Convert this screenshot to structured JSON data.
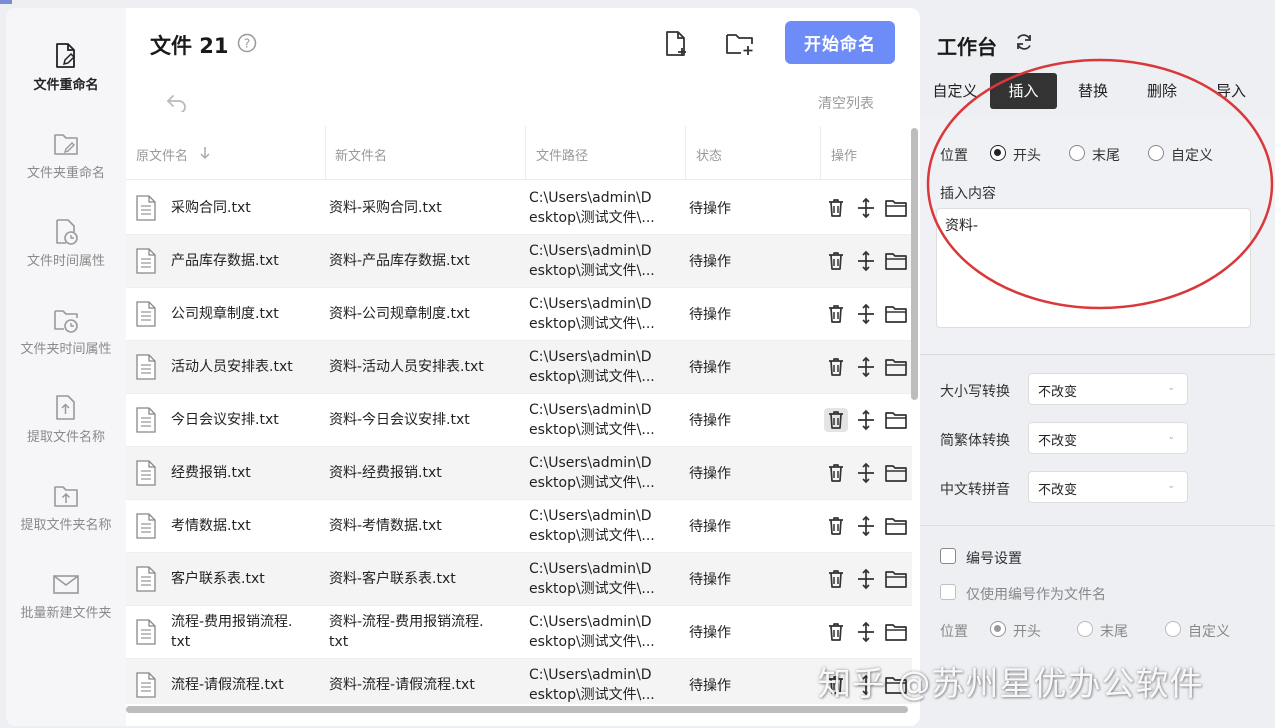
{
  "sidebar": {
    "items": [
      {
        "label": "文件重命名",
        "icon": "file-edit-icon",
        "active": true
      },
      {
        "label": "文件夹重命名",
        "icon": "folder-edit-icon",
        "active": false
      },
      {
        "label": "文件时间属性",
        "icon": "file-clock-icon",
        "active": false
      },
      {
        "label": "文件夹时间属性",
        "icon": "folder-clock-icon",
        "active": false
      },
      {
        "label": "提取文件名称",
        "icon": "file-upload-icon",
        "active": false
      },
      {
        "label": "提取文件夹名称",
        "icon": "folder-upload-icon",
        "active": false
      },
      {
        "label": "批量新建文件夹",
        "icon": "mail-folder-icon",
        "active": false
      }
    ]
  },
  "header": {
    "title": "文件 21",
    "start_button": "开始命名",
    "clear_list": "清空列表"
  },
  "table": {
    "columns": [
      "原文件名",
      "新文件名",
      "文件路径",
      "状态",
      "操作"
    ],
    "rows": [
      {
        "orig": "采购合同.txt",
        "new": "资料-采购合同.txt",
        "path1": "C:\\Users\\admin\\D",
        "path2": "esktop\\测试文件\\...",
        "status": "待操作"
      },
      {
        "orig": "产品库存数据.txt",
        "new": "资料-产品库存数据.txt",
        "path1": "C:\\Users\\admin\\D",
        "path2": "esktop\\测试文件\\...",
        "status": "待操作"
      },
      {
        "orig": "公司规章制度.txt",
        "new": "资料-公司规章制度.txt",
        "path1": "C:\\Users\\admin\\D",
        "path2": "esktop\\测试文件\\...",
        "status": "待操作"
      },
      {
        "orig": "活动人员安排表.txt",
        "new": "资料-活动人员安排表.txt",
        "path1": "C:\\Users\\admin\\D",
        "path2": "esktop\\测试文件\\...",
        "status": "待操作"
      },
      {
        "orig": "今日会议安排.txt",
        "new": "资料-今日会议安排.txt",
        "path1": "C:\\Users\\admin\\D",
        "path2": "esktop\\测试文件\\...",
        "status": "待操作"
      },
      {
        "orig": "经费报销.txt",
        "new": "资料-经费报销.txt",
        "path1": "C:\\Users\\admin\\D",
        "path2": "esktop\\测试文件\\...",
        "status": "待操作"
      },
      {
        "orig": "考情数据.txt",
        "new": "资料-考情数据.txt",
        "path1": "C:\\Users\\admin\\D",
        "path2": "esktop\\测试文件\\...",
        "status": "待操作"
      },
      {
        "orig": "客户联系表.txt",
        "new": "资料-客户联系表.txt",
        "path1": "C:\\Users\\admin\\D",
        "path2": "esktop\\测试文件\\...",
        "status": "待操作"
      },
      {
        "orig": "流程-费用报销流程.txt",
        "orig1": "流程-费用报销流程.",
        "orig2": "txt",
        "new": "资料-流程-费用报销流程.txt",
        "new1": "资料-流程-费用报销流程.",
        "new2": "txt",
        "path1": "C:\\Users\\admin\\D",
        "path2": "esktop\\测试文件\\...",
        "status": "待操作"
      },
      {
        "orig": "流程-请假流程.txt",
        "new": "资料-流程-请假流程.txt",
        "path1": "C:\\Users\\admin\\D",
        "path2": "esktop\\测试文件\\...",
        "status": "待操作"
      }
    ]
  },
  "panel": {
    "title": "工作台",
    "tabs": [
      "自定义",
      "插入",
      "替换",
      "删除",
      "导入"
    ],
    "active_tab": "插入",
    "position_label": "位置",
    "position_options": [
      "开头",
      "末尾",
      "自定义"
    ],
    "position_selected": "开头",
    "insert_content_label": "插入内容",
    "insert_content_value": "资料-",
    "case_label": "大小写转换",
    "case_value": "不改变",
    "trad_label": "简繁体转换",
    "trad_value": "不改变",
    "pinyin_label": "中文转拼音",
    "pinyin_value": "不改变",
    "numbering_label": "编号设置",
    "numbering_only_label": "仅使用编号作为文件名",
    "num_position_label": "位置",
    "num_position_options": [
      "开头",
      "末尾",
      "自定义"
    ]
  },
  "watermark": "知乎 @苏州星优办公软件",
  "colors": {
    "accent": "#6e8cf7",
    "tab_active": "#333333",
    "annotation": "#d9383a"
  }
}
